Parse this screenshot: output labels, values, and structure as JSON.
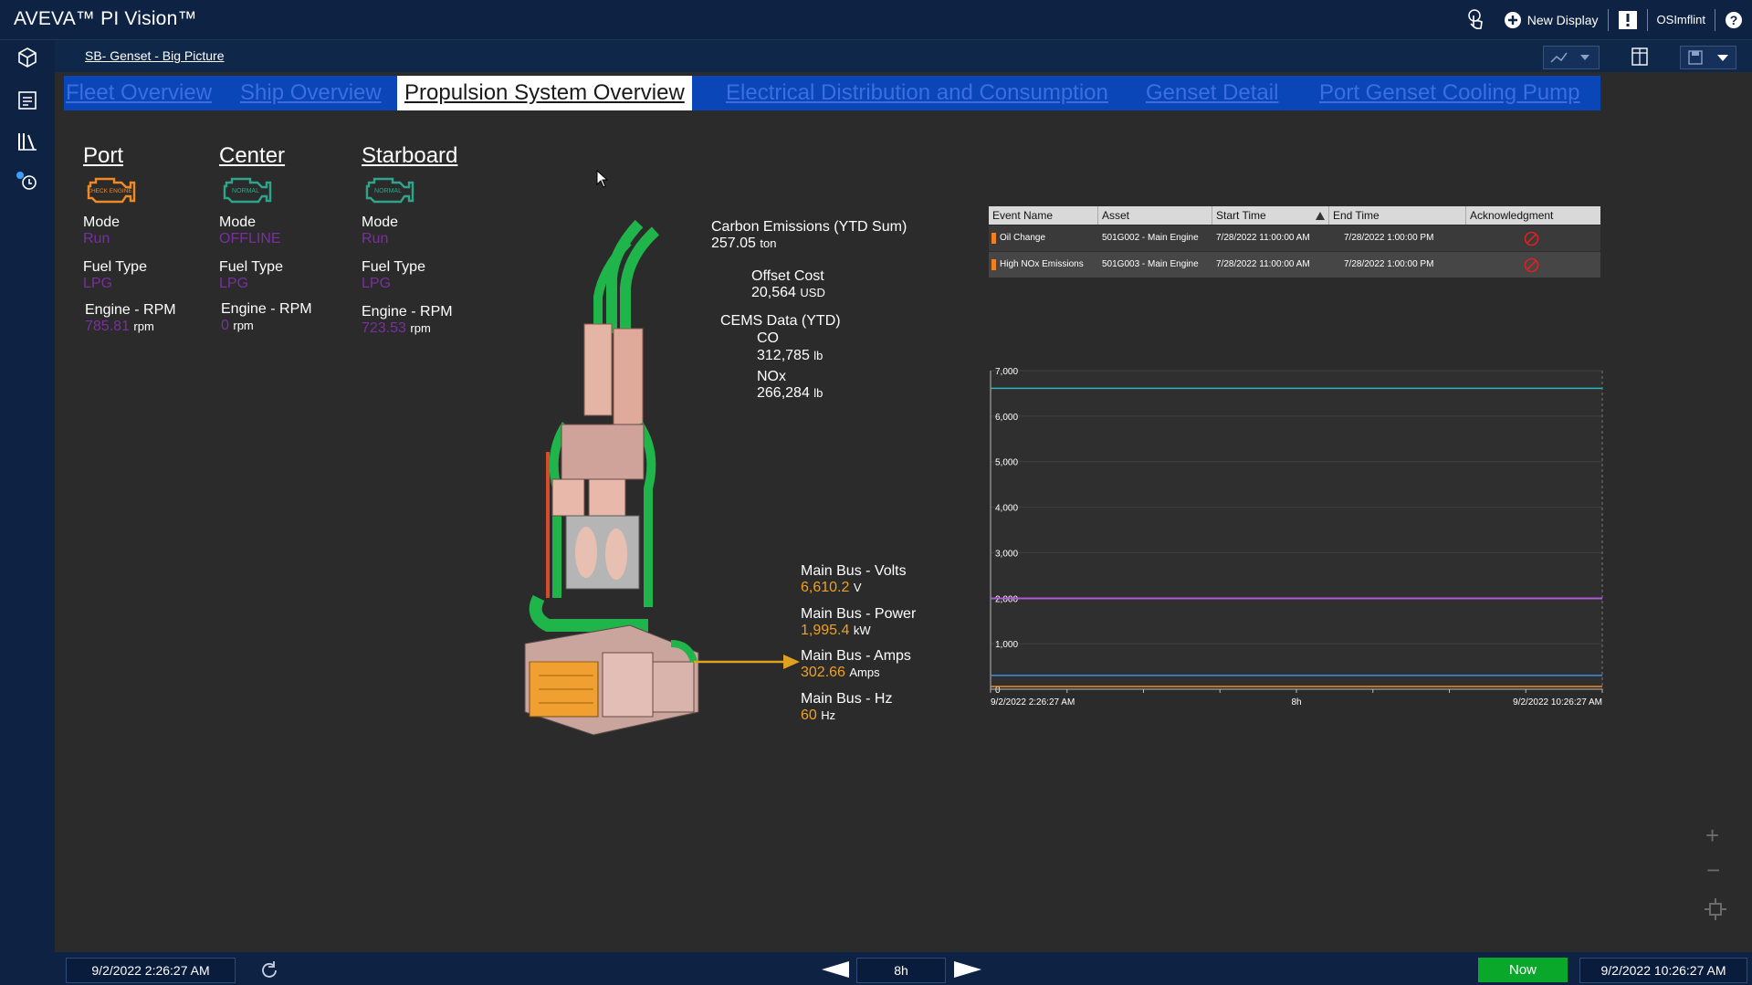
{
  "app": {
    "title": "AVEVA™ PI Vision™"
  },
  "header": {
    "new_display_label": "New Display",
    "user": "OSImflint"
  },
  "breadcrumb": "SB- Genset - Big Picture",
  "tabs": [
    {
      "label": "Fleet Overview",
      "active": false
    },
    {
      "label": "Ship Overview",
      "active": false
    },
    {
      "label": "Propulsion System Overview",
      "active": true
    },
    {
      "label": "Electrical Distribution and Consumption",
      "active": false
    },
    {
      "label": "Genset Detail",
      "active": false
    },
    {
      "label": "Port Genset Cooling Pump",
      "active": false
    }
  ],
  "engines": [
    {
      "name": "Port",
      "badge": "CHECK ENGINE",
      "badge_color": "#f08a24",
      "mode_label": "Mode",
      "mode": "Run",
      "fuel_label": "Fuel Type",
      "fuel": "LPG",
      "rpm_label": "Engine - RPM",
      "rpm": "785.81",
      "rpm_unit": "rpm"
    },
    {
      "name": "Center",
      "badge": "NORMAL",
      "badge_color": "#2ea58a",
      "mode_label": "Mode",
      "mode": "OFFLINE",
      "fuel_label": "Fuel Type",
      "fuel": "LPG",
      "rpm_label": "Engine - RPM",
      "rpm": "0",
      "rpm_unit": "rpm"
    },
    {
      "name": "Starboard",
      "badge": "NORMAL",
      "badge_color": "#2ea58a",
      "mode_label": "Mode",
      "mode": "Run",
      "fuel_label": "Fuel Type",
      "fuel": "LPG",
      "rpm_label": "Engine - RPM",
      "rpm": "723.53",
      "rpm_unit": "rpm"
    }
  ],
  "emissions": {
    "carbon_label": "Carbon Emissions (YTD Sum)",
    "carbon_value": "257.05",
    "carbon_unit": "ton",
    "offset_label": "Offset Cost",
    "offset_value": "20,564",
    "offset_unit": "USD",
    "cems_label": "CEMS Data (YTD)",
    "co_label": "CO",
    "co_value": "312,785",
    "co_unit": "lb",
    "nox_label": "NOx",
    "nox_value": "266,284",
    "nox_unit": "lb"
  },
  "main_bus": [
    {
      "label": "Main Bus - Volts",
      "value": "6,610.2",
      "unit": "V"
    },
    {
      "label": "Main Bus - Power",
      "value": "1,995.4",
      "unit": "kW"
    },
    {
      "label": "Main Bus - Amps",
      "value": "302.66",
      "unit": "Amps"
    },
    {
      "label": "Main Bus - Hz",
      "value": "60",
      "unit": "Hz"
    }
  ],
  "event_table": {
    "headers": [
      "Event Name",
      "Asset",
      "Start Time",
      "End Time",
      "Acknowledgment"
    ],
    "rows": [
      {
        "event": "Oil Change",
        "asset": "501G002 - Main Engine",
        "start": "7/28/2022 11:00:00 AM",
        "end": "7/28/2022 1:00:00 PM"
      },
      {
        "event": "High NOx Emissions",
        "asset": "501G003 - Main Engine",
        "start": "7/28/2022 11:00:00 AM",
        "end": "7/28/2022 1:00:00 PM"
      }
    ]
  },
  "chart_data": {
    "type": "line",
    "ylim": [
      0,
      7000
    ],
    "yticks": [
      "7,000",
      "6,000",
      "5,000",
      "4,000",
      "3,000",
      "2,000",
      "1,000",
      "0"
    ],
    "x_start": "9/2/2022 2:26:27 AM",
    "x_mid": "8h",
    "x_end": "9/2/2022 10:26:27 AM",
    "series": [
      {
        "name": "Main Bus - Volts",
        "value_label": "6,610.2 V",
        "color": "#2bb3c0",
        "y": 6610.2
      },
      {
        "name": "Main Bus - Power",
        "value_label": "1,995.4 kW",
        "color": "#b25ad8",
        "y": 1995.4
      },
      {
        "name": "Main Bus - Amps",
        "value_label": "302.66 Amps",
        "color": "#3a8fd8",
        "y": 302.66
      },
      {
        "name": "Main Bus - Hz",
        "value_label": "60 Hz",
        "color": "#f08a24",
        "y": 60
      }
    ]
  },
  "time_bar": {
    "start": "9/2/2022 2:26:27 AM",
    "duration": "8h",
    "now_label": "Now",
    "end": "9/2/2022 10:26:27 AM"
  }
}
